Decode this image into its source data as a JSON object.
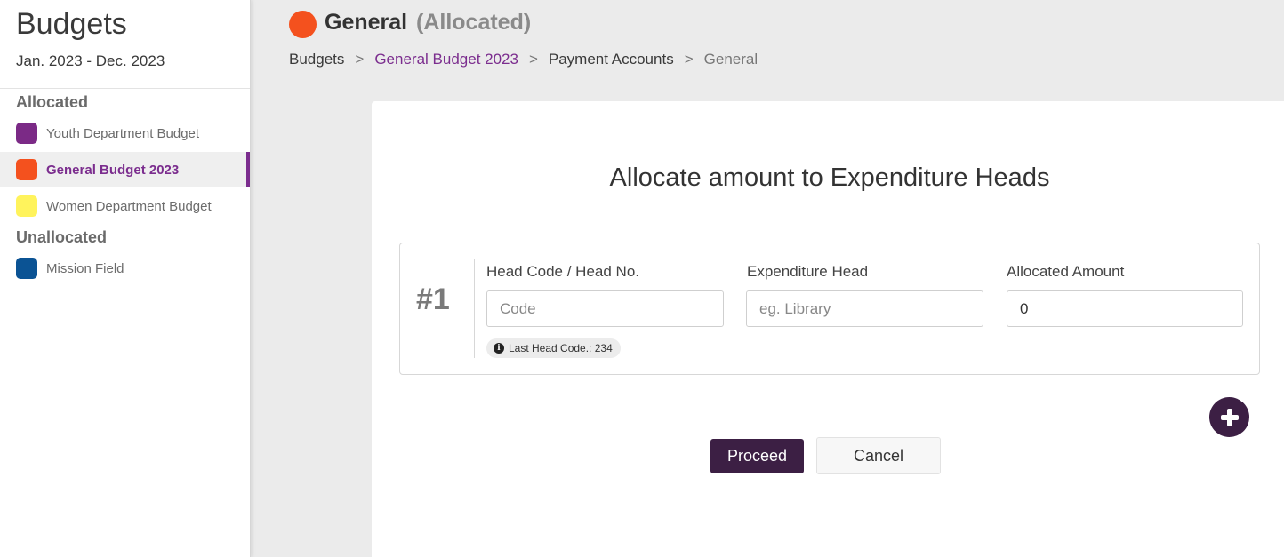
{
  "sidebar": {
    "title": "Budgets",
    "period": "Jan. 2023 - Dec. 2023",
    "sections": [
      {
        "title": "Allocated",
        "items": [
          {
            "label": "Youth Department Budget",
            "color": "#7b2a86"
          },
          {
            "label": "General Budget 2023",
            "color": "#f4511e",
            "active": true
          },
          {
            "label": "Women Department Budget",
            "color": "#fff35c"
          }
        ]
      },
      {
        "title": "Unallocated",
        "items": [
          {
            "label": "Mission Field",
            "color": "#0b5394"
          }
        ]
      }
    ]
  },
  "header": {
    "dot_color": "#f4511e",
    "title": "General",
    "status": "(Allocated)",
    "breadcrumb": [
      "Budgets",
      "General Budget 2023",
      "Payment Accounts",
      "General"
    ],
    "separator": ">"
  },
  "form": {
    "heading": "Allocate amount to Expenditure Heads",
    "rows": [
      {
        "number": "#1",
        "head_code_label": "Head Code / Head No.",
        "head_code_placeholder": "Code",
        "head_code_value": "",
        "expenditure_label": "Expenditure Head",
        "expenditure_placeholder": "eg. Library",
        "expenditure_value": "",
        "amount_label": "Allocated Amount",
        "amount_value": "0",
        "hint": "Last Head Code.: 234"
      }
    ],
    "add_icon": "plus-icon",
    "proceed_label": "Proceed",
    "cancel_label": "Cancel"
  },
  "colors": {
    "accent": "#7b2d8e",
    "primary_button": "#3c1f44"
  }
}
